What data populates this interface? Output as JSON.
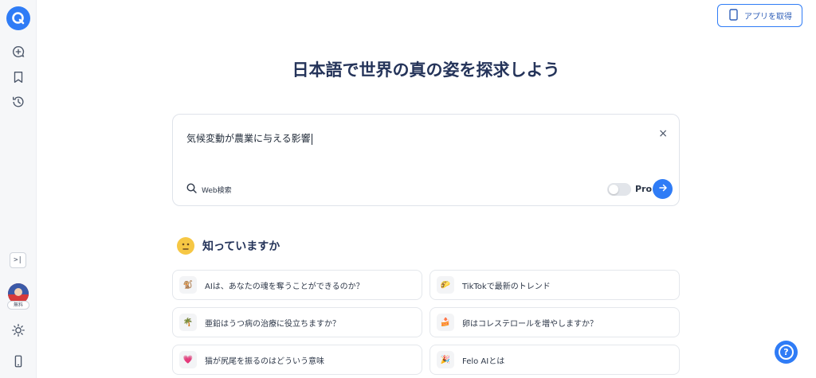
{
  "header": {
    "get_app_label": "アプリを取得"
  },
  "main": {
    "title": "日本語で世界の真の姿を探求しよう"
  },
  "search": {
    "query": "気候変動が農業に与える影響",
    "clear_icon": "×",
    "web_search_label": "Web検索",
    "pro_label": "Pro",
    "pro_enabled": false
  },
  "sidebar": {
    "collapse_label": ">|",
    "avatar_badge": "無料"
  },
  "did_you_know": {
    "title": "知っていますか",
    "emoji": "🤔",
    "cards": [
      {
        "icon": "🐒",
        "text": "AIは、あなたの魂を奪うことができるのか？"
      },
      {
        "icon": "🌮",
        "text": "TikTokで最新のトレンド"
      },
      {
        "icon": "🌴",
        "text": "亜鉛はうつ病の治療に役立ちますか？"
      },
      {
        "icon": "🍰",
        "text": "卵はコレステロールを増やしますか？"
      },
      {
        "icon": "💗",
        "text": "猫が尻尾を振るのはどういう意味"
      },
      {
        "icon": "🎉",
        "text": "Felo AIとは"
      }
    ]
  },
  "colors": {
    "accent": "#2f7cf6",
    "title": "#25345a"
  }
}
